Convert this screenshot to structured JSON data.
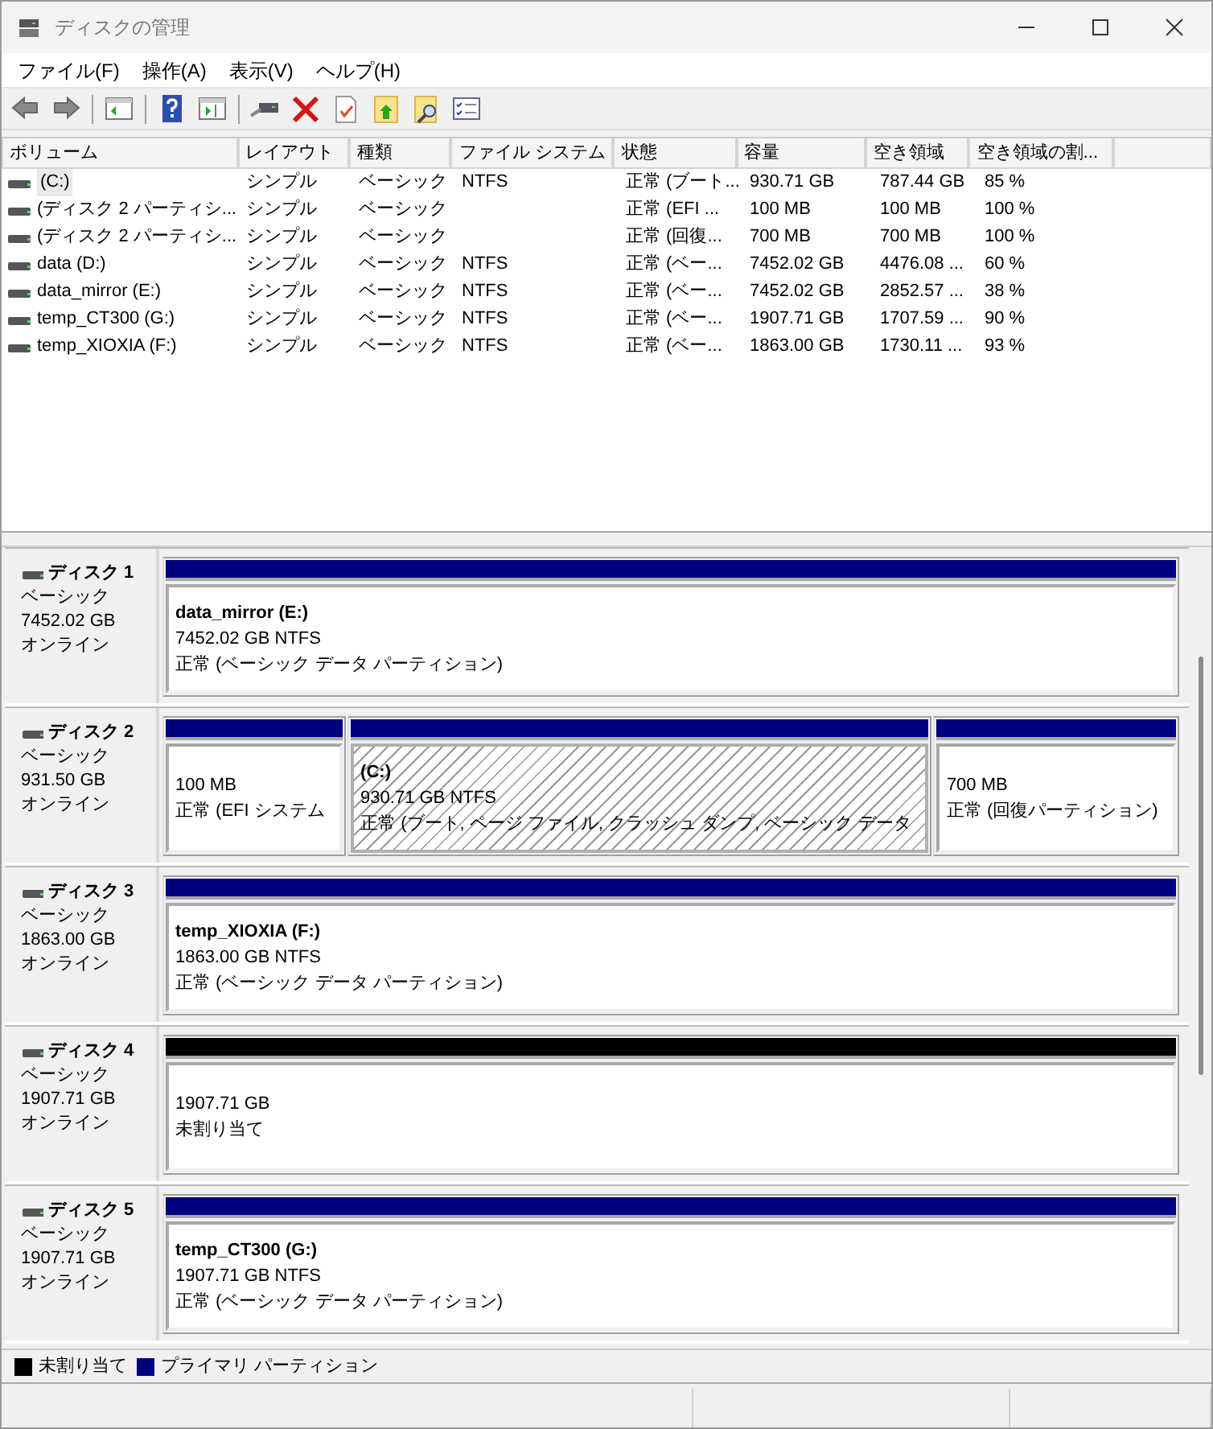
{
  "window": {
    "title": "ディスクの管理"
  },
  "menu": [
    "ファイル(F)",
    "操作(A)",
    "表示(V)",
    "ヘルプ(H)"
  ],
  "volume_table": {
    "columns": [
      "ボリューム",
      "レイアウト",
      "種類",
      "ファイル システム",
      "状態",
      "容量",
      "空き領域",
      "空き領域の割..."
    ],
    "rows": [
      {
        "selected": true,
        "cells": [
          "(C:)",
          "シンプル",
          "ベーシック",
          "NTFS",
          "正常 (ブート...",
          "930.71 GB",
          "787.44 GB",
          "85 %"
        ]
      },
      {
        "selected": false,
        "cells": [
          "(ディスク 2 パーティシ...",
          "シンプル",
          "ベーシック",
          "",
          "正常 (EFI ...",
          "100 MB",
          "100 MB",
          "100 %"
        ]
      },
      {
        "selected": false,
        "cells": [
          "(ディスク 2 パーティシ...",
          "シンプル",
          "ベーシック",
          "",
          "正常 (回復...",
          "700 MB",
          "700 MB",
          "100 %"
        ]
      },
      {
        "selected": false,
        "cells": [
          "data (D:)",
          "シンプル",
          "ベーシック",
          "NTFS",
          "正常 (ベー...",
          "7452.02 GB",
          "4476.08 ...",
          "60 %"
        ]
      },
      {
        "selected": false,
        "cells": [
          "data_mirror (E:)",
          "シンプル",
          "ベーシック",
          "NTFS",
          "正常 (ベー...",
          "7452.02 GB",
          "2852.57 ...",
          "38 %"
        ]
      },
      {
        "selected": false,
        "cells": [
          "temp_CT300 (G:)",
          "シンプル",
          "ベーシック",
          "NTFS",
          "正常 (ベー...",
          "1907.71 GB",
          "1707.59 ...",
          "90 %"
        ]
      },
      {
        "selected": false,
        "cells": [
          "temp_XIOXIA (F:)",
          "シンプル",
          "ベーシック",
          "NTFS",
          "正常 (ベー...",
          "1863.00 GB",
          "1730.11 ...",
          "93 %"
        ]
      }
    ]
  },
  "disks": [
    {
      "label": "ディスク 1",
      "type": "ベーシック",
      "size": "7452.02 GB",
      "status": "オンライン",
      "partitions": [
        {
          "kind": "primary",
          "selected": false,
          "name": "data_mirror  (E:)",
          "size": "7452.02 GB NTFS",
          "status": "正常 (ベーシック データ パーティション)"
        }
      ]
    },
    {
      "label": "ディスク 2",
      "type": "ベーシック",
      "size": "931.50 GB",
      "status": "オンライン",
      "partitions": [
        {
          "kind": "primary",
          "selected": false,
          "size": "100 MB",
          "status": "正常 (EFI システム"
        },
        {
          "kind": "primary",
          "selected": true,
          "name": "(C:)",
          "size": "930.71 GB NTFS",
          "status": "正常 (ブート, ページ ファイル, クラッシュ ダンプ, ベーシック データ"
        },
        {
          "kind": "primary",
          "selected": false,
          "size": "700 MB",
          "status": "正常 (回復パーティション)"
        }
      ]
    },
    {
      "label": "ディスク 3",
      "type": "ベーシック",
      "size": "1863.00 GB",
      "status": "オンライン",
      "partitions": [
        {
          "kind": "primary",
          "selected": false,
          "name": "temp_XIOXIA  (F:)",
          "size": "1863.00 GB NTFS",
          "status": "正常 (ベーシック データ パーティション)"
        }
      ]
    },
    {
      "label": "ディスク 4",
      "type": "ベーシック",
      "size": "1907.71 GB",
      "status": "オンライン",
      "partitions": [
        {
          "kind": "unallocated",
          "selected": false,
          "size": "1907.71 GB",
          "status": "未割り当て"
        }
      ]
    },
    {
      "label": "ディスク 5",
      "type": "ベーシック",
      "size": "1907.71 GB",
      "status": "オンライン",
      "partitions": [
        {
          "kind": "primary",
          "selected": false,
          "name": "temp_CT300  (G:)",
          "size": "1907.71 GB NTFS",
          "status": "正常 (ベーシック データ パーティション)"
        }
      ]
    }
  ],
  "legend": [
    {
      "label": "未割り当て",
      "color": "#000000"
    },
    {
      "label": "プライマリ パーティション",
      "color": "#000080"
    }
  ]
}
